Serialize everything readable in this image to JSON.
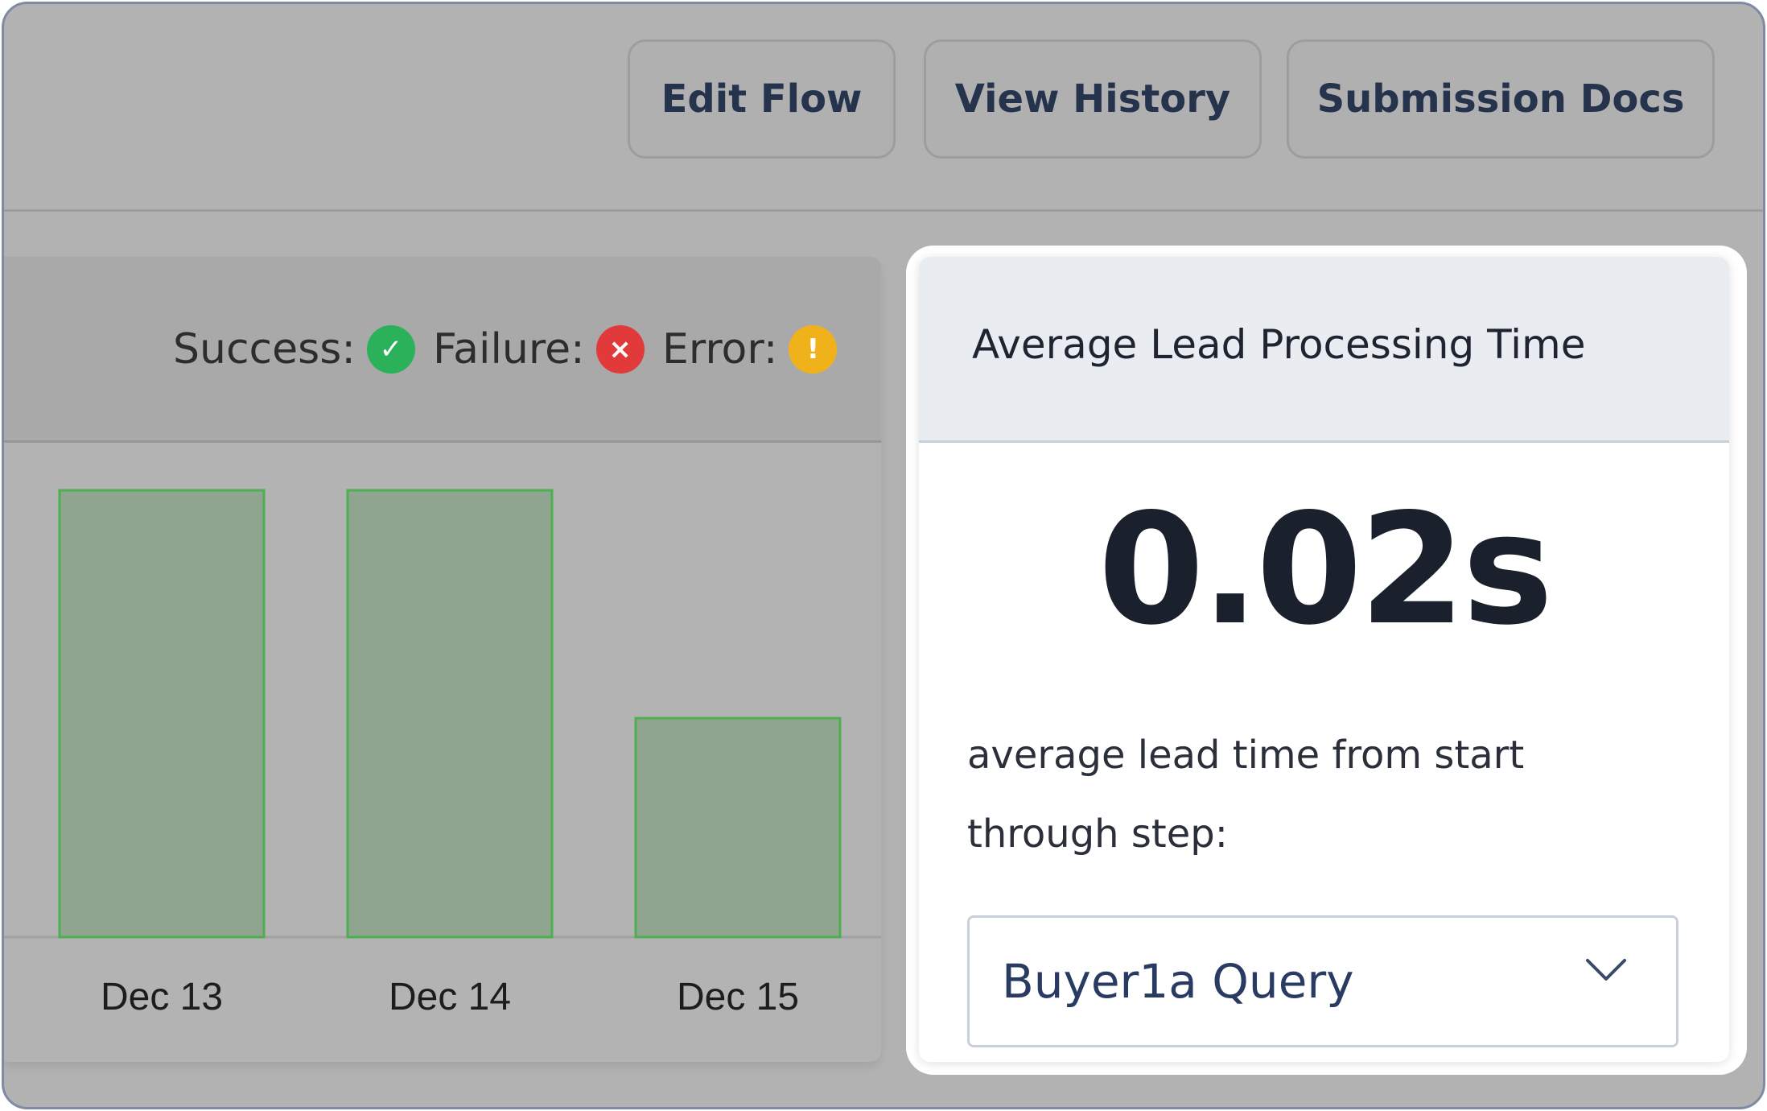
{
  "toolbar": {
    "edit_flow": "Edit Flow",
    "view_history": "View History",
    "submission_docs": "Submission Docs"
  },
  "legend": {
    "success_label": "Success:",
    "failure_label": "Failure:",
    "error_label": "Error:",
    "success_color": "#2bb15a",
    "failure_color": "#e23a3a",
    "error_color": "#f0b21a",
    "success_icon": "check-icon",
    "failure_icon": "x-icon",
    "error_icon": "exclamation-icon",
    "success_glyph": "✓",
    "failure_glyph": "×",
    "error_glyph": "!"
  },
  "chart_data": {
    "type": "bar",
    "categories": [
      "Dec 13",
      "Dec 14",
      "Dec 15"
    ],
    "series": [
      {
        "values": [
          100,
          100,
          49
        ]
      }
    ],
    "bar_color": "#8fa58f",
    "bar_border_color": "#4caf50"
  },
  "card": {
    "title": "Average Lead Processing Time",
    "value": "0.02s",
    "description": "average lead time from start through step:",
    "select_value": "Buyer1a Query",
    "select_icon": "chevron-down-icon"
  }
}
